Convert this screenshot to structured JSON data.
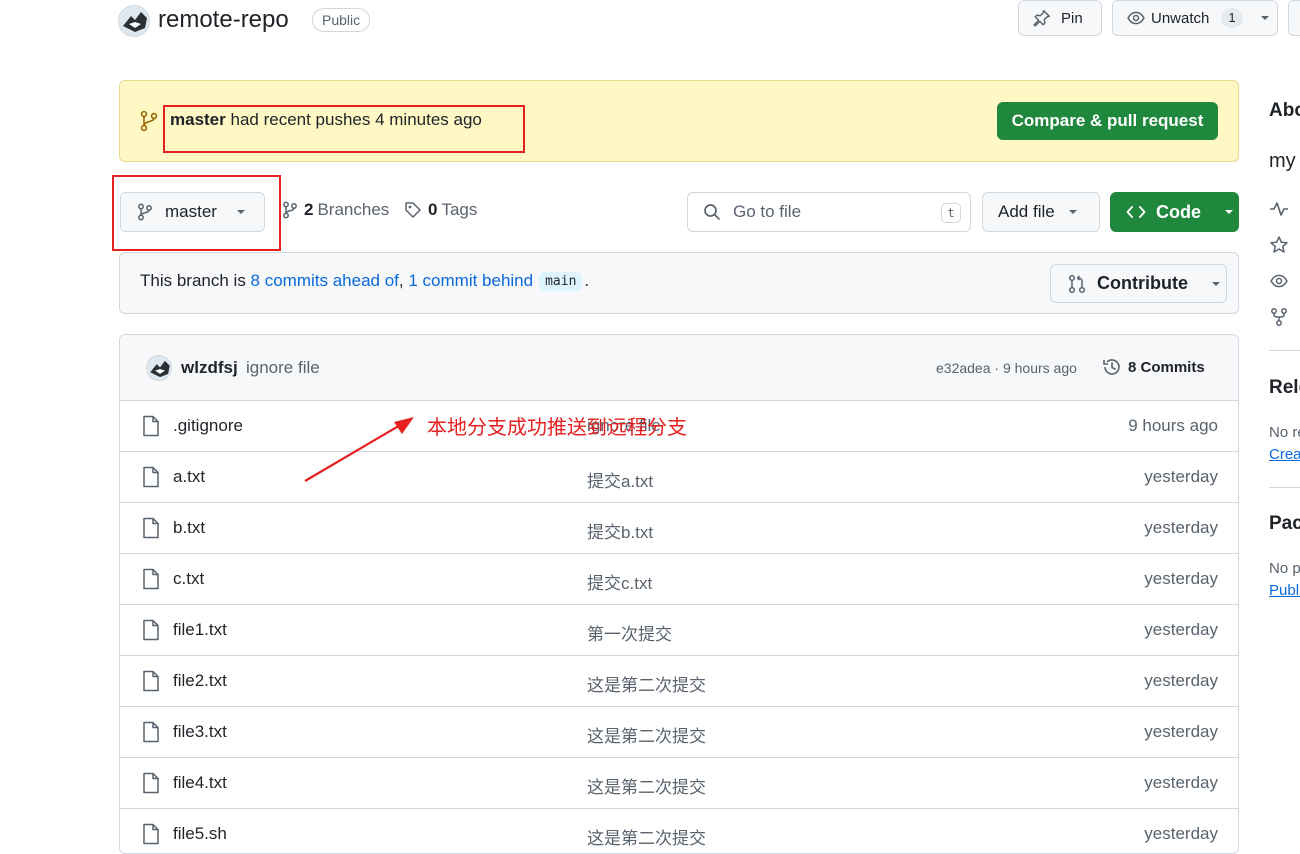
{
  "header": {
    "repo_name": "remote-repo",
    "visibility": "Public",
    "pin_label": "Pin",
    "unwatch_label": "Unwatch",
    "watch_count": "1"
  },
  "push_banner": {
    "branch": "master",
    "message": " had recent pushes 4 minutes ago",
    "compare_label": "Compare & pull request"
  },
  "toolbar": {
    "branch_name": "master",
    "branches_count": "2",
    "branches_label": "Branches",
    "tags_count": "0",
    "tags_label": "Tags",
    "goto_placeholder": "Go to file",
    "goto_shortcut": "t",
    "add_file_label": "Add file",
    "code_label": "Code"
  },
  "ahead_behind": {
    "prefix": "This branch is ",
    "ahead_link": "8 commits ahead of",
    "comma": ", ",
    "behind_link": "1 commit behind",
    "base_branch": "main",
    "suffix": ".",
    "contribute_label": "Contribute"
  },
  "latest_commit": {
    "author": "wlzdfsj",
    "message": "ignore file",
    "hash_time": "e32adea · 9 hours ago",
    "commits_label": "8 Commits"
  },
  "files": [
    {
      "name": ".gitignore",
      "message": "ignore file",
      "date": "9 hours ago"
    },
    {
      "name": "a.txt",
      "message": "提交a.txt",
      "date": "yesterday"
    },
    {
      "name": "b.txt",
      "message": "提交b.txt",
      "date": "yesterday"
    },
    {
      "name": "c.txt",
      "message": "提交c.txt",
      "date": "yesterday"
    },
    {
      "name": "file1.txt",
      "message": "第一次提交",
      "date": "yesterday"
    },
    {
      "name": "file2.txt",
      "message": "这是第二次提交",
      "date": "yesterday"
    },
    {
      "name": "file3.txt",
      "message": "这是第二次提交",
      "date": "yesterday"
    },
    {
      "name": "file4.txt",
      "message": "这是第二次提交",
      "date": "yesterday"
    },
    {
      "name": "file5.sh",
      "message": "这是第二次提交",
      "date": "yesterday"
    }
  ],
  "sidebar": {
    "about_heading": "Abo",
    "about_desc": "my",
    "releases_heading": "Rele",
    "releases_text": "No re",
    "releases_link": "Creat",
    "packages_heading": "Pac",
    "packages_text": "No p",
    "packages_link": "Publi"
  },
  "annotation": {
    "text": "本地分支成功推送到远程分支",
    "color": "#e62020"
  },
  "colors": {
    "primary_green": "#1f883d",
    "link_blue": "#0969da",
    "banner_yellow": "#fff8c5",
    "muted_text": "#59636e",
    "border": "#d0d7de"
  }
}
